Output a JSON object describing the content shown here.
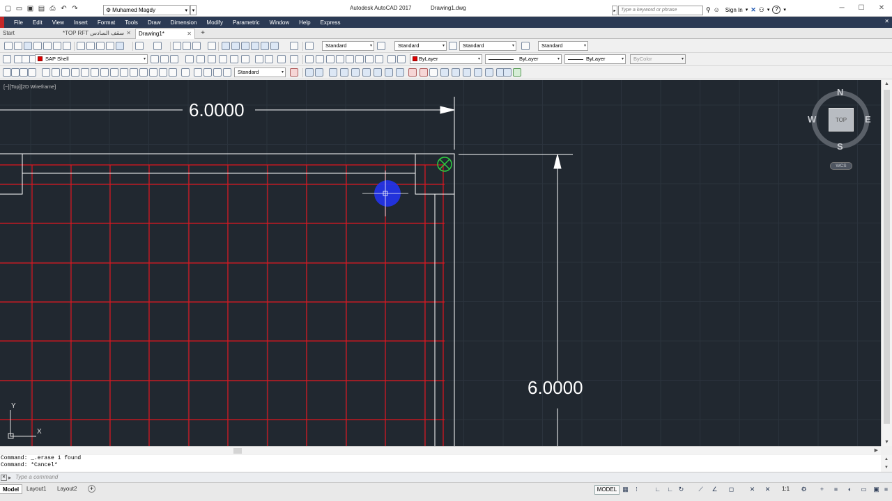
{
  "titlebar": {
    "workspace": "Muhamed Magdy",
    "app_title": "Autodesk AutoCAD 2017",
    "doc_title": "Drawing1.dwg",
    "search_placeholder": "Type a keyword or phrase",
    "signin": "Sign In"
  },
  "menu": [
    "File",
    "Edit",
    "View",
    "Insert",
    "Format",
    "Tools",
    "Draw",
    "Dimension",
    "Modify",
    "Parametric",
    "Window",
    "Help",
    "Express"
  ],
  "file_tabs": {
    "start": "Start",
    "tab2": "سقف السادس TOP RFT*",
    "tab3": "Drawing1*"
  },
  "toolbars": {
    "text_style": "Standard",
    "dim_style": "Standard",
    "table_style": "Standard",
    "mleader_style": "Standard",
    "layer": "SAP Shell",
    "color": "ByLayer",
    "linetype": "ByLayer",
    "lineweight": "ByLayer",
    "plotstyle": "ByColor",
    "visual_style": "Standard"
  },
  "viewport": {
    "label": "[−][Top][2D Wireframe]",
    "dim_horizontal": "6.0000",
    "dim_vertical": "6.0000"
  },
  "viewcube": {
    "face": "TOP",
    "north": "N",
    "south": "S",
    "east": "E",
    "west": "W",
    "wcs": "WCS"
  },
  "ucs": {
    "x": "X",
    "y": "Y"
  },
  "command": {
    "history_1": "Command: _.erase 1 found",
    "history_2": "Command: *Cancel*",
    "placeholder": "Type a command"
  },
  "layout_tabs": [
    "Model",
    "Layout1",
    "Layout2"
  ],
  "status": {
    "model": "MODEL",
    "scale": "1:1"
  },
  "colors": {
    "canvas_bg": "#212830",
    "rebar_red": "#e0141e",
    "outline_white": "#ffffff",
    "menubar": "#2b3a54",
    "cursor_blue": "#2233ee",
    "snap_green": "#2ecc40"
  }
}
